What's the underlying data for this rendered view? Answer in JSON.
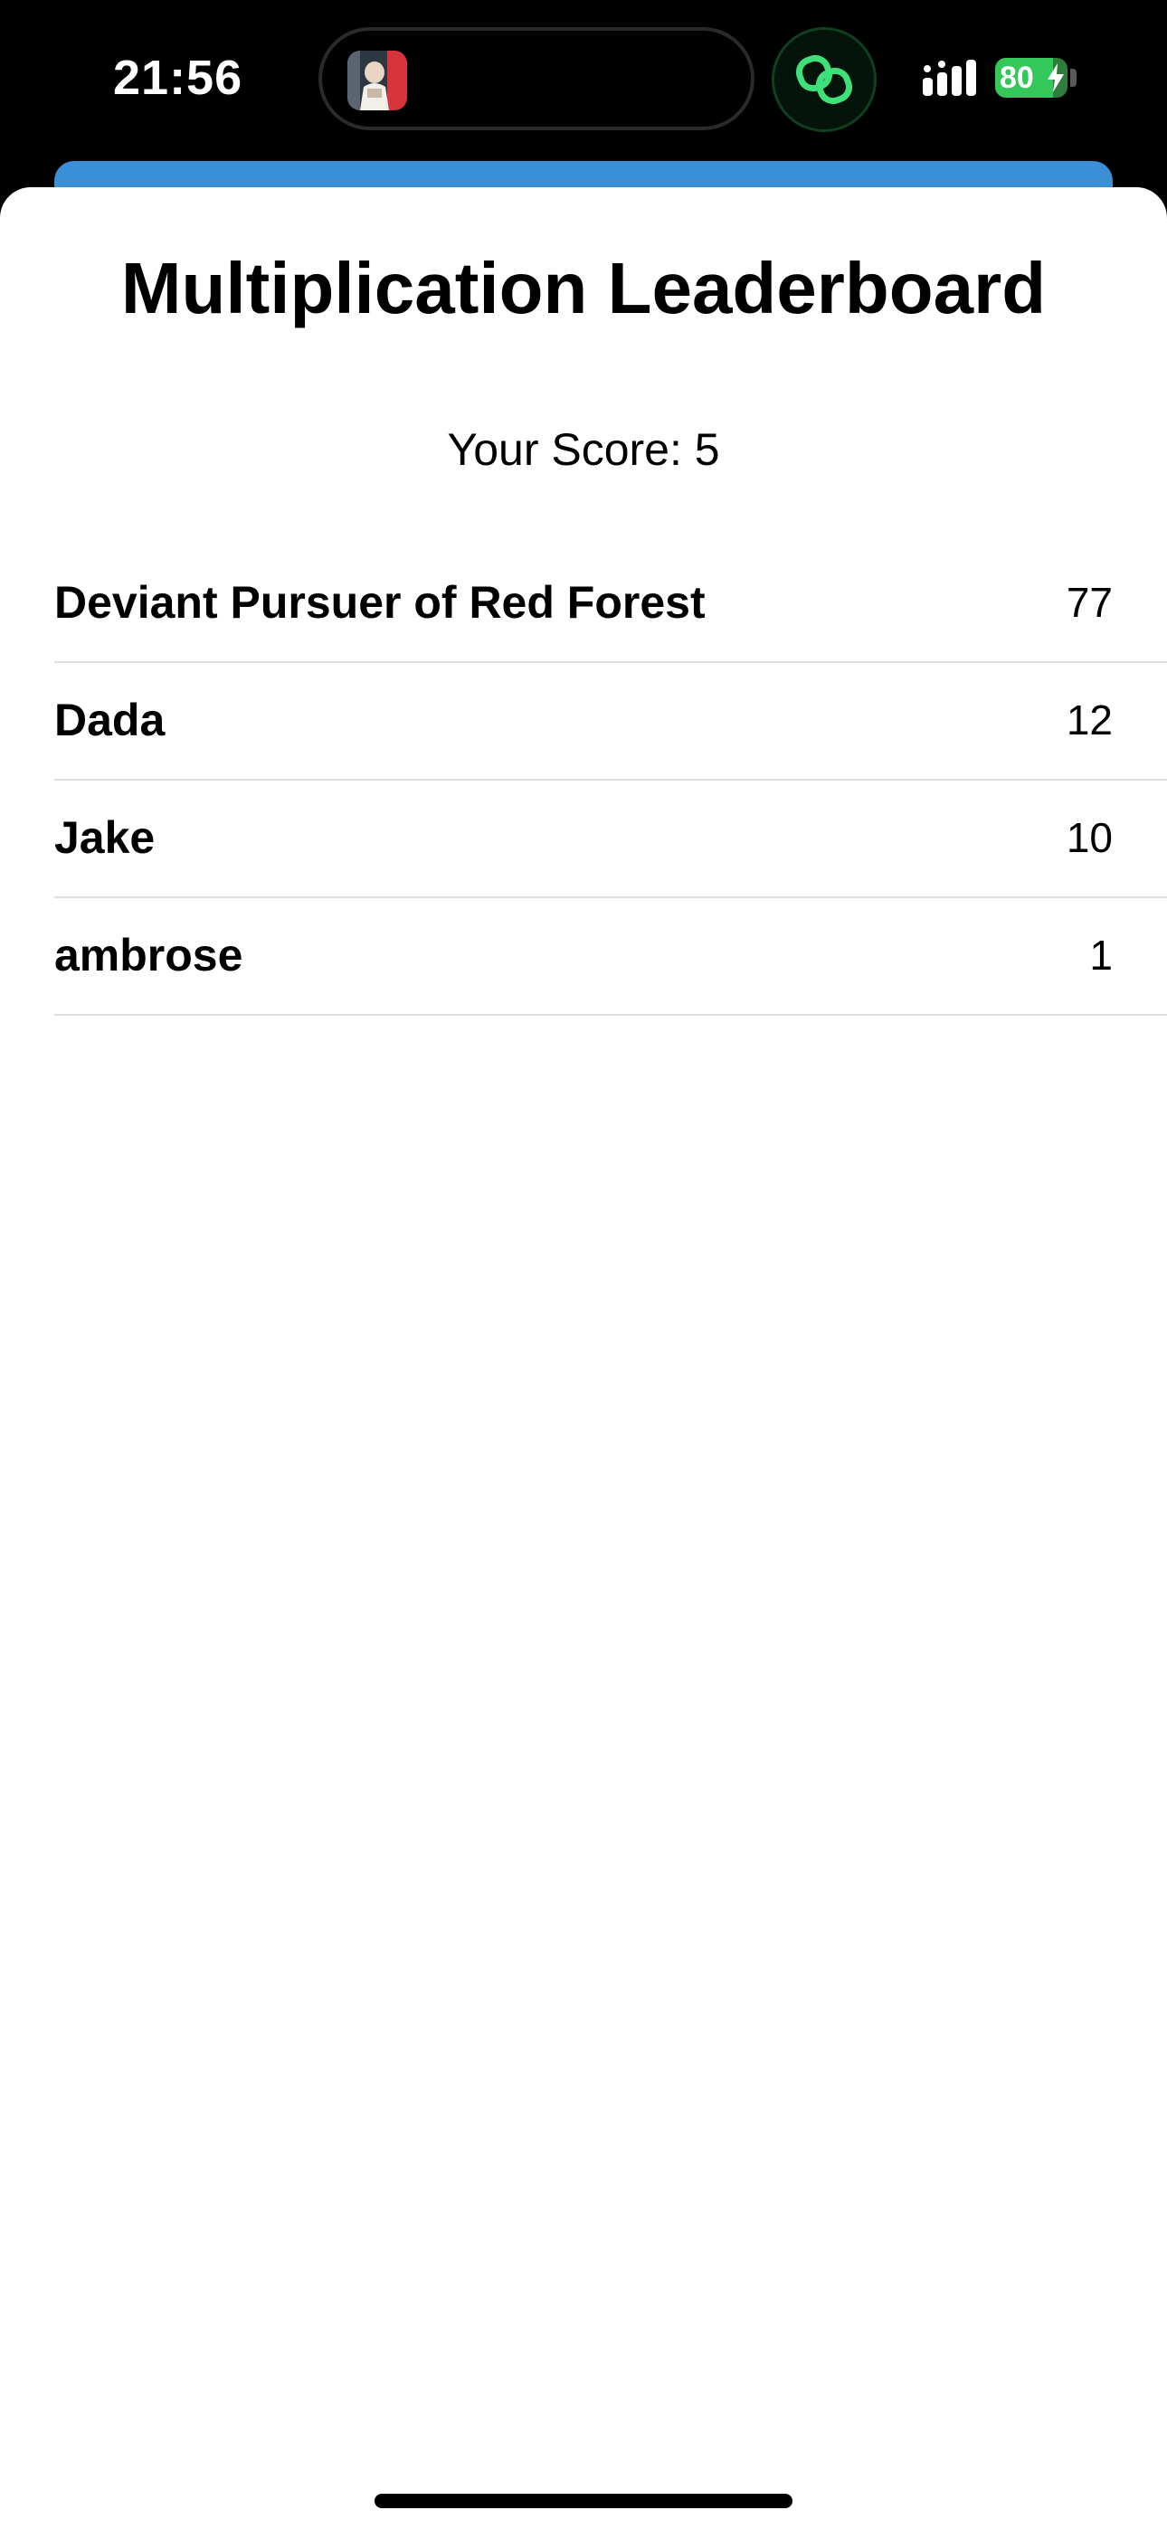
{
  "status_bar": {
    "time": "21:56",
    "battery_percent": "80",
    "battery_level": 0.8,
    "battery_charging": true,
    "accent_green": "#34c759",
    "live_activity_icon": "link-rings-icon",
    "signal_icon": "cellular-signal-icon"
  },
  "backdrop": {
    "color": "#3b8fd6"
  },
  "leaderboard": {
    "title": "Multiplication Leaderboard",
    "your_score": "Your Score: 5",
    "entries": [
      {
        "name": "Deviant Pursuer of Red Forest",
        "score": "77"
      },
      {
        "name": "Dada",
        "score": "12"
      },
      {
        "name": "Jake",
        "score": "10"
      },
      {
        "name": "ambrose",
        "score": "1"
      }
    ]
  }
}
